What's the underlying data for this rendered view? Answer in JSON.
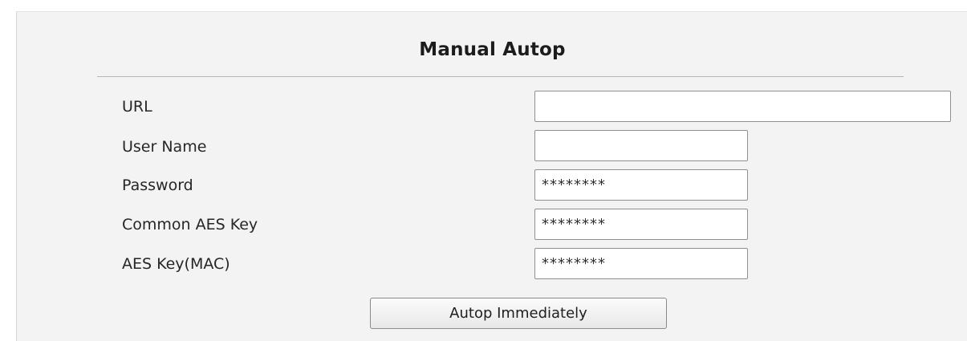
{
  "section": {
    "title": "Manual Autop"
  },
  "form": {
    "url": {
      "label": "URL",
      "value": ""
    },
    "user_name": {
      "label": "User Name",
      "value": ""
    },
    "password": {
      "label": "Password",
      "value": "********"
    },
    "common_aes_key": {
      "label": "Common AES Key",
      "value": "********"
    },
    "aes_key_mac": {
      "label": "AES Key(MAC)",
      "value": "********"
    }
  },
  "actions": {
    "autop_immediately_label": "Autop Immediately"
  }
}
